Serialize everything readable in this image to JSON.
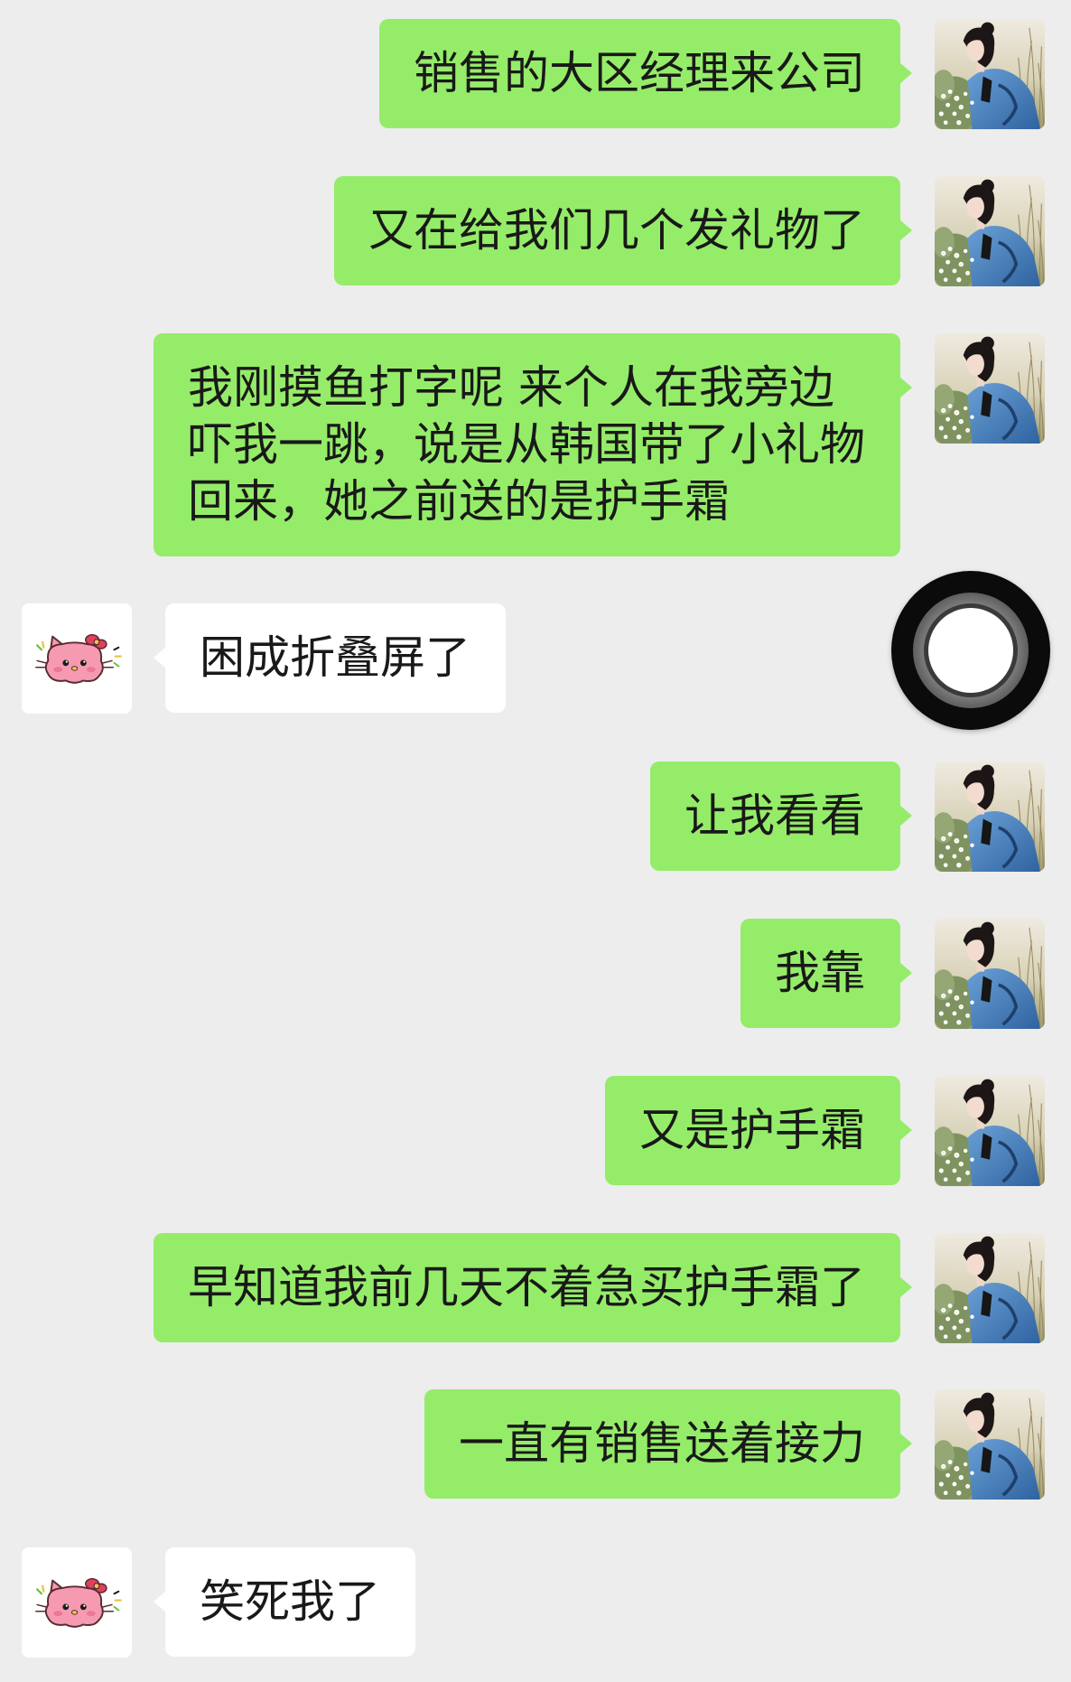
{
  "colors": {
    "background": "#ededed",
    "outgoing_bubble": "#95ec69",
    "incoming_bubble": "#ffffff",
    "text": "#191919"
  },
  "avatars": {
    "self_icon": "avatar-photo-woman-denim-jacket",
    "other_icon": "pink-kitty-sticker"
  },
  "floating_button": {
    "icon": "assistive-touch-icon"
  },
  "messages": [
    {
      "side": "outgoing",
      "lines": [
        "销售的大区经理来公司"
      ]
    },
    {
      "side": "outgoing",
      "lines": [
        "又在给我们几个发礼物了"
      ]
    },
    {
      "side": "outgoing",
      "lines": [
        "我刚摸鱼打字呢 来个人在我旁边",
        "吓我一跳，说是从韩国带了小礼物",
        "回来，她之前送的是护手霜"
      ]
    },
    {
      "side": "incoming",
      "lines": [
        "困成折叠屏了"
      ]
    },
    {
      "side": "outgoing",
      "lines": [
        "让我看看"
      ]
    },
    {
      "side": "outgoing",
      "lines": [
        "我靠"
      ]
    },
    {
      "side": "outgoing",
      "lines": [
        "又是护手霜"
      ]
    },
    {
      "side": "outgoing",
      "lines": [
        "早知道我前几天不着急买护手霜了"
      ]
    },
    {
      "side": "outgoing",
      "lines": [
        "一直有销售送着接力"
      ]
    },
    {
      "side": "incoming",
      "lines": [
        "笑死我了"
      ]
    }
  ]
}
